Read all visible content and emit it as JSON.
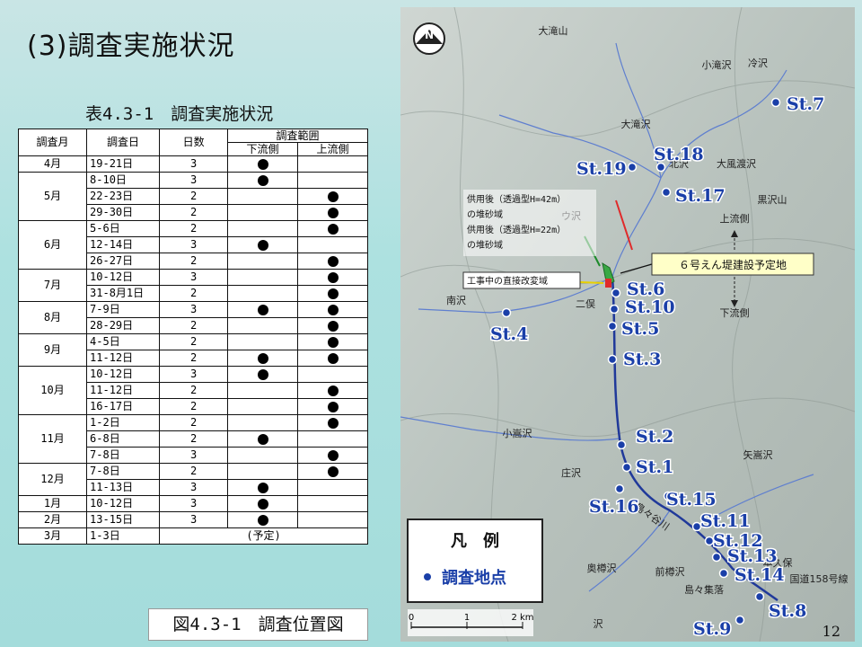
{
  "slide": {
    "title": "(3)調査実施状況",
    "page_number": "12"
  },
  "table": {
    "caption": "表4.3-1　調査実施状況",
    "headers": {
      "month": "調査月",
      "date": "調査日",
      "days": "日数",
      "range": "調査範囲",
      "down": "下流側",
      "up": "上流側"
    },
    "rows": [
      {
        "month": "4月",
        "date": "19-21日",
        "days": "3",
        "down": true,
        "up": false,
        "span": 1
      },
      {
        "month": "5月",
        "date": "8-10日",
        "days": "3",
        "down": true,
        "up": false,
        "span": 3
      },
      {
        "month": "",
        "date": "22-23日",
        "days": "2",
        "down": false,
        "up": true
      },
      {
        "month": "",
        "date": "29-30日",
        "days": "2",
        "down": false,
        "up": true
      },
      {
        "month": "6月",
        "date": "5-6日",
        "days": "2",
        "down": false,
        "up": true,
        "span": 3
      },
      {
        "month": "",
        "date": "12-14日",
        "days": "3",
        "down": true,
        "up": false
      },
      {
        "month": "",
        "date": "26-27日",
        "days": "2",
        "down": false,
        "up": true
      },
      {
        "month": "7月",
        "date": "10-12日",
        "days": "3",
        "down": false,
        "up": true,
        "span": 2
      },
      {
        "month": "",
        "date": "31-8月1日",
        "days": "2",
        "down": false,
        "up": true
      },
      {
        "month": "8月",
        "date": "7-9日",
        "days": "3",
        "down": true,
        "up": true,
        "span": 2
      },
      {
        "month": "",
        "date": "28-29日",
        "days": "2",
        "down": false,
        "up": true
      },
      {
        "month": "9月",
        "date": "4-5日",
        "days": "2",
        "down": false,
        "up": true,
        "span": 2
      },
      {
        "month": "",
        "date": "11-12日",
        "days": "2",
        "down": true,
        "up": true
      },
      {
        "month": "10月",
        "date": "10-12日",
        "days": "3",
        "down": true,
        "up": false,
        "span": 3
      },
      {
        "month": "",
        "date": "11-12日",
        "days": "2",
        "down": false,
        "up": true
      },
      {
        "month": "",
        "date": "16-17日",
        "days": "2",
        "down": false,
        "up": true
      },
      {
        "month": "11月",
        "date": "1-2日",
        "days": "2",
        "down": false,
        "up": true,
        "span": 3
      },
      {
        "month": "",
        "date": "6-8日",
        "days": "2",
        "down": true,
        "up": false
      },
      {
        "month": "",
        "date": "7-8日",
        "days": "3",
        "down": false,
        "up": true
      },
      {
        "month": "12月",
        "date": "7-8日",
        "days": "2",
        "down": false,
        "up": true,
        "span": 2
      },
      {
        "month": "",
        "date": "11-13日",
        "days": "3",
        "down": true,
        "up": false
      },
      {
        "month": "1月",
        "date": "10-12日",
        "days": "3",
        "down": true,
        "up": false,
        "span": 1
      },
      {
        "month": "2月",
        "date": "13-15日",
        "days": "3",
        "down": true,
        "up": false,
        "span": 1
      },
      {
        "month": "3月",
        "date": "1-3日",
        "days": "",
        "note": "(予定)",
        "down": false,
        "up": false,
        "span": 1
      }
    ]
  },
  "figure_caption": "図4.3-1　調査位置図",
  "map": {
    "legend_title": "凡　例",
    "legend_item": "調査地点",
    "scale": [
      "0",
      "1",
      "2 km"
    ],
    "north": "N",
    "dam_label": "６号えん堤建設予定地",
    "annotations": [
      "供用後（透過型H=42m）",
      "の堆砂域",
      "供用後（透過型H=22m）",
      "の堆砂域",
      "工事中の直接改変域"
    ],
    "direction_up": "上流側",
    "direction_down": "下流側",
    "place_names": [
      "大滝山",
      "小滝沢",
      "冷沢",
      "大滝沢",
      "北沢",
      "大風渡沢",
      "黒沢山",
      "ウ沢",
      "南沢",
      "二俣",
      "小嵩沢",
      "矢嵩沢",
      "庄沢",
      "島々谷川",
      "奥樽沢",
      "前樽沢",
      "島々集落",
      "国道158号線",
      "本久保",
      "沢"
    ],
    "stations": [
      "St.7",
      "St.18",
      "St.19",
      "St.17",
      "St.6",
      "St.10",
      "St.5",
      "St.4",
      "St.3",
      "St.2",
      "St.1",
      "St.15",
      "St.16",
      "St.11",
      "St.12",
      "St.13",
      "St.14",
      "St.8",
      "St.9"
    ]
  }
}
